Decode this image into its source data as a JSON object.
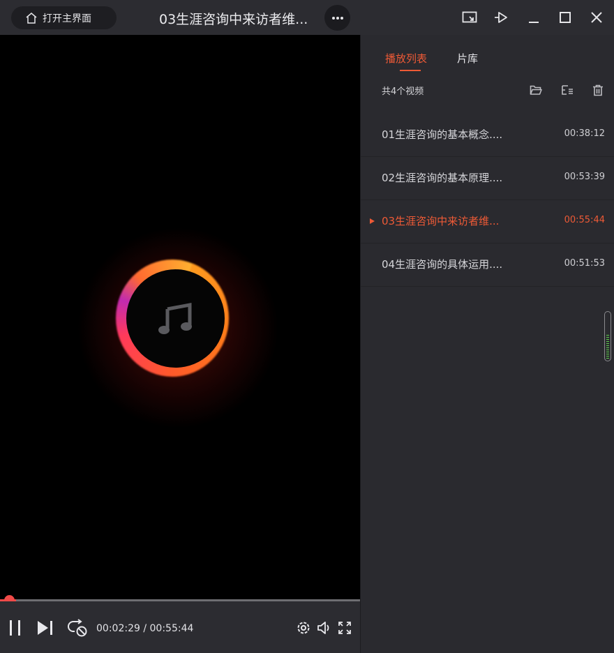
{
  "titlebar": {
    "home_label": "打开主界面",
    "title": "03生涯咨询中来访者维...",
    "icons": [
      "home-icon",
      "more-icon",
      "mini-mode-icon",
      "pin-icon",
      "minimize-icon",
      "maximize-icon",
      "close-icon"
    ]
  },
  "player": {
    "current_time": "00:02:29",
    "separator": " / ",
    "total_time": "00:55:44",
    "progress_fraction": 0.045,
    "accent": "#f04a48",
    "icons": [
      "pause-icon",
      "next-icon",
      "loop-icon",
      "settings-icon",
      "volume-icon",
      "fullscreen-icon",
      "music-note-icon"
    ]
  },
  "panel": {
    "tabs": [
      {
        "label": "播放列表",
        "active": true
      },
      {
        "label": "片库",
        "active": false
      }
    ],
    "count_label": "共4个视频",
    "tool_icons": [
      "open-folder-icon",
      "playlist-icon",
      "trash-icon"
    ],
    "accent": "#ee5a36",
    "items": [
      {
        "name": "01生涯咨询的基本概念....",
        "duration": "00:38:12",
        "active": false
      },
      {
        "name": "02生涯咨询的基本原理....",
        "duration": "00:53:39",
        "active": false
      },
      {
        "name": "03生涯咨询中来访者维...",
        "duration": "00:55:44",
        "active": true
      },
      {
        "name": "04生涯咨询的具体运用....",
        "duration": "00:51:53",
        "active": false
      }
    ]
  }
}
